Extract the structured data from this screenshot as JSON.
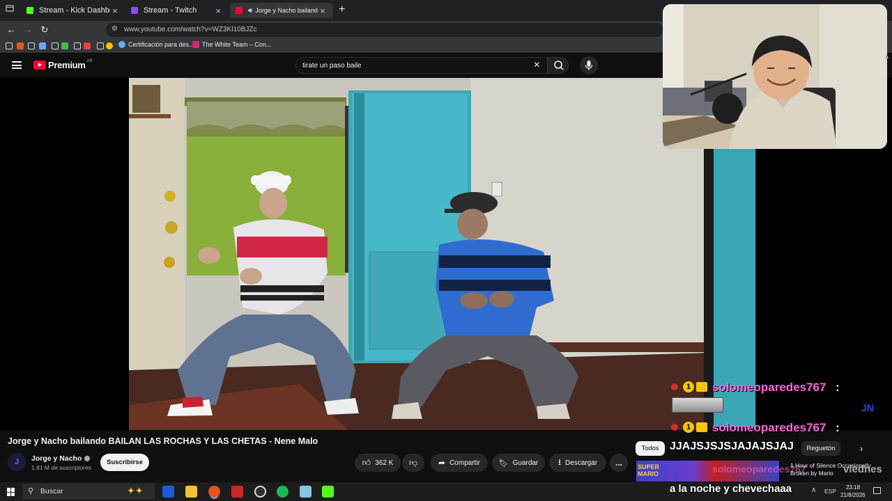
{
  "browser": {
    "tabs": [
      {
        "title": "Stream - Kick Dashboard",
        "color": "#53fc18"
      },
      {
        "title": "Stream - Twitch",
        "color": "#9146ff"
      },
      {
        "title": "Jorge y Nacho bailando BAILAN",
        "color": "#ff0033"
      }
    ],
    "new_tab": "+",
    "url": "www.youtube.com/watch?v=WZ3Kl10BJZc",
    "bookmarks": [
      {
        "label": "Certificación para des..."
      },
      {
        "label": "The White Team – Con..."
      }
    ]
  },
  "youtube": {
    "logo_text": "Premium",
    "country": "AR",
    "search_value": "tirate un paso baile",
    "video": {
      "title": "Jorge y Nacho bailando BAILAN LAS ROCHAS Y LAS CHETAS - Nene Malo",
      "channel": "Jorge y Nacho",
      "subscribers": "1.81 M de suscriptores",
      "subscribe": "Suscribirse",
      "likes": "362 K",
      "share": "Compartir",
      "save": "Guardar",
      "download": "Descargar",
      "more": "..."
    },
    "chips": {
      "all": "Todos",
      "reggaeton": "Reguetón"
    },
    "suggestion": {
      "title": "1 Hour of Silence Occasionally Broken by Mario",
      "thumb": "SUPER MARIO"
    }
  },
  "chat": {
    "messages": [
      {
        "user": "solomeoparedes767",
        "colon": ":"
      },
      {
        "user": "solomeoparedes767",
        "colon": ":"
      }
    ],
    "partial_user": "solomeoparedes767",
    "partial_text": "viednes",
    "big_text": "JJAJSJSJSJAJAJSJAJ",
    "bottom_text": "a la noche y chevechaaa"
  },
  "taskbar": {
    "search": "Buscar",
    "lang": "ESP",
    "time": "23:18",
    "date": "21/8/2026"
  },
  "colors": {
    "yt_red": "#ff0033",
    "chat_name": "#ff66dd",
    "kick_green": "#53fc18",
    "twitch_purple": "#9146ff"
  }
}
